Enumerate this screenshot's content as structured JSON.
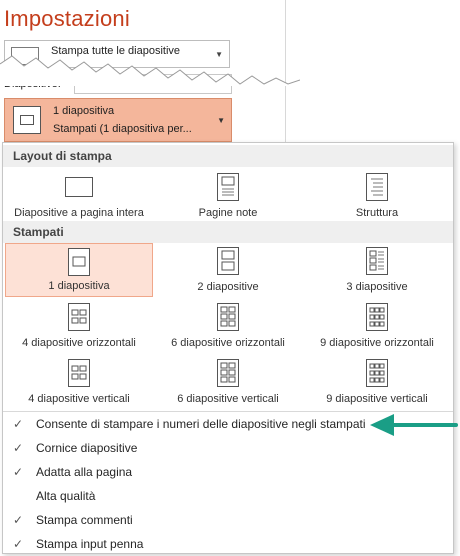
{
  "header": {
    "title": "Impostazioni",
    "print_all_label": "Stampa tutte le diapositive",
    "slides_label": "Diapositive:",
    "layout_line1": "1 diapositiva",
    "layout_line2": "Stampati (1 diapositiva per..."
  },
  "panel": {
    "print_layout_header": "Layout di stampa",
    "print_layout_items": [
      {
        "label": "Diapositive a pagina intera"
      },
      {
        "label": "Pagine note"
      },
      {
        "label": "Struttura"
      }
    ],
    "handouts_header": "Stampati",
    "handout_items": [
      {
        "label": "1 diapositiva",
        "selected": true
      },
      {
        "label": "2 diapositive"
      },
      {
        "label": "3 diapositive"
      },
      {
        "label": "4 diapositive orizzontali"
      },
      {
        "label": "6 diapositive orizzontali"
      },
      {
        "label": "9 diapositive orizzontali"
      },
      {
        "label": "4 diapositive verticali"
      },
      {
        "label": "6 diapositive verticali"
      },
      {
        "label": "9 diapositive verticali"
      }
    ],
    "options": [
      {
        "label": "Consente di stampare i numeri delle diapositive negli stampati",
        "checked": true
      },
      {
        "label": "Cornice diapositive",
        "checked": true
      },
      {
        "label": "Adatta alla pagina",
        "checked": true
      },
      {
        "label": "Alta qualità",
        "checked": false
      },
      {
        "label": "Stampa commenti",
        "checked": true
      },
      {
        "label": "Stampa input penna",
        "checked": true
      }
    ]
  },
  "colors": {
    "title": "#c43e1c",
    "selected_dropdown": "#f4b69b",
    "selected_tile": "#fde1d6",
    "annotation_arrow": "#1a9e86"
  },
  "icons": {
    "check": "✓",
    "dropdown_arrow": "▼"
  }
}
